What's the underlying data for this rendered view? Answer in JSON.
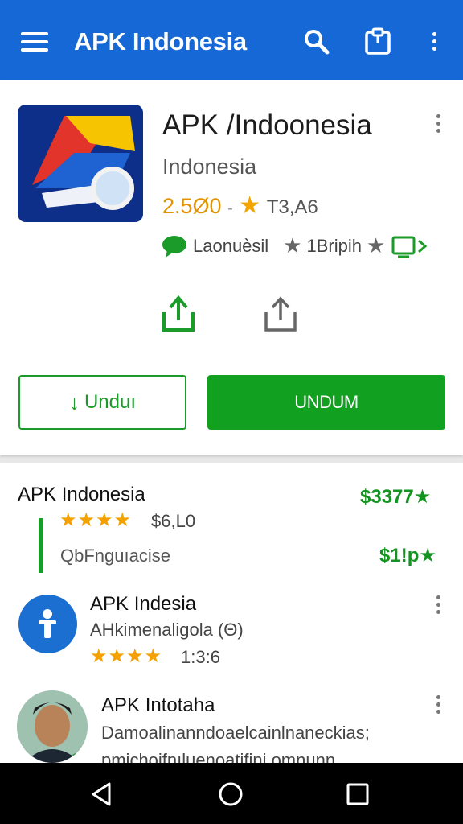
{
  "appbar": {
    "title": "APK Indonesia"
  },
  "app": {
    "title": "APK /Indoonesia",
    "subtitle": "Indonesia",
    "rating": "2.5Ø0",
    "rating_dash": "-",
    "star": "★",
    "reviews": "T3,A6",
    "badge1": "Laonuèsil",
    "badge2": "1Bripih"
  },
  "buttons": {
    "outline_label": "Unduı",
    "solid_label": "UNDUM"
  },
  "section": {
    "title": "APK Indonesia",
    "price1": "$3377★",
    "stars": "★★★★",
    "stars_text": "$6,L0",
    "desc": "QbFnguıacise",
    "price2": "$1!p★"
  },
  "items": [
    {
      "title": "APK Indesia",
      "sub": "AHkimenaligola (Θ)",
      "stars": "★★★★",
      "count": "1:3:6"
    },
    {
      "title": "APK Intotaha",
      "line1": "Damoalinanndoaelcainlnaneckias;",
      "line2": "pmichoifnıluenoatifini omnunn"
    }
  ],
  "colors": {
    "appbar": "#1668d6",
    "accent_green": "#12a021",
    "star": "#f4a400"
  },
  "icons": [
    "menu-icon",
    "search-icon",
    "clipboard-icon",
    "more-vert-icon",
    "update-icon",
    "share-icon",
    "back-icon",
    "home-icon",
    "recents-icon"
  ]
}
